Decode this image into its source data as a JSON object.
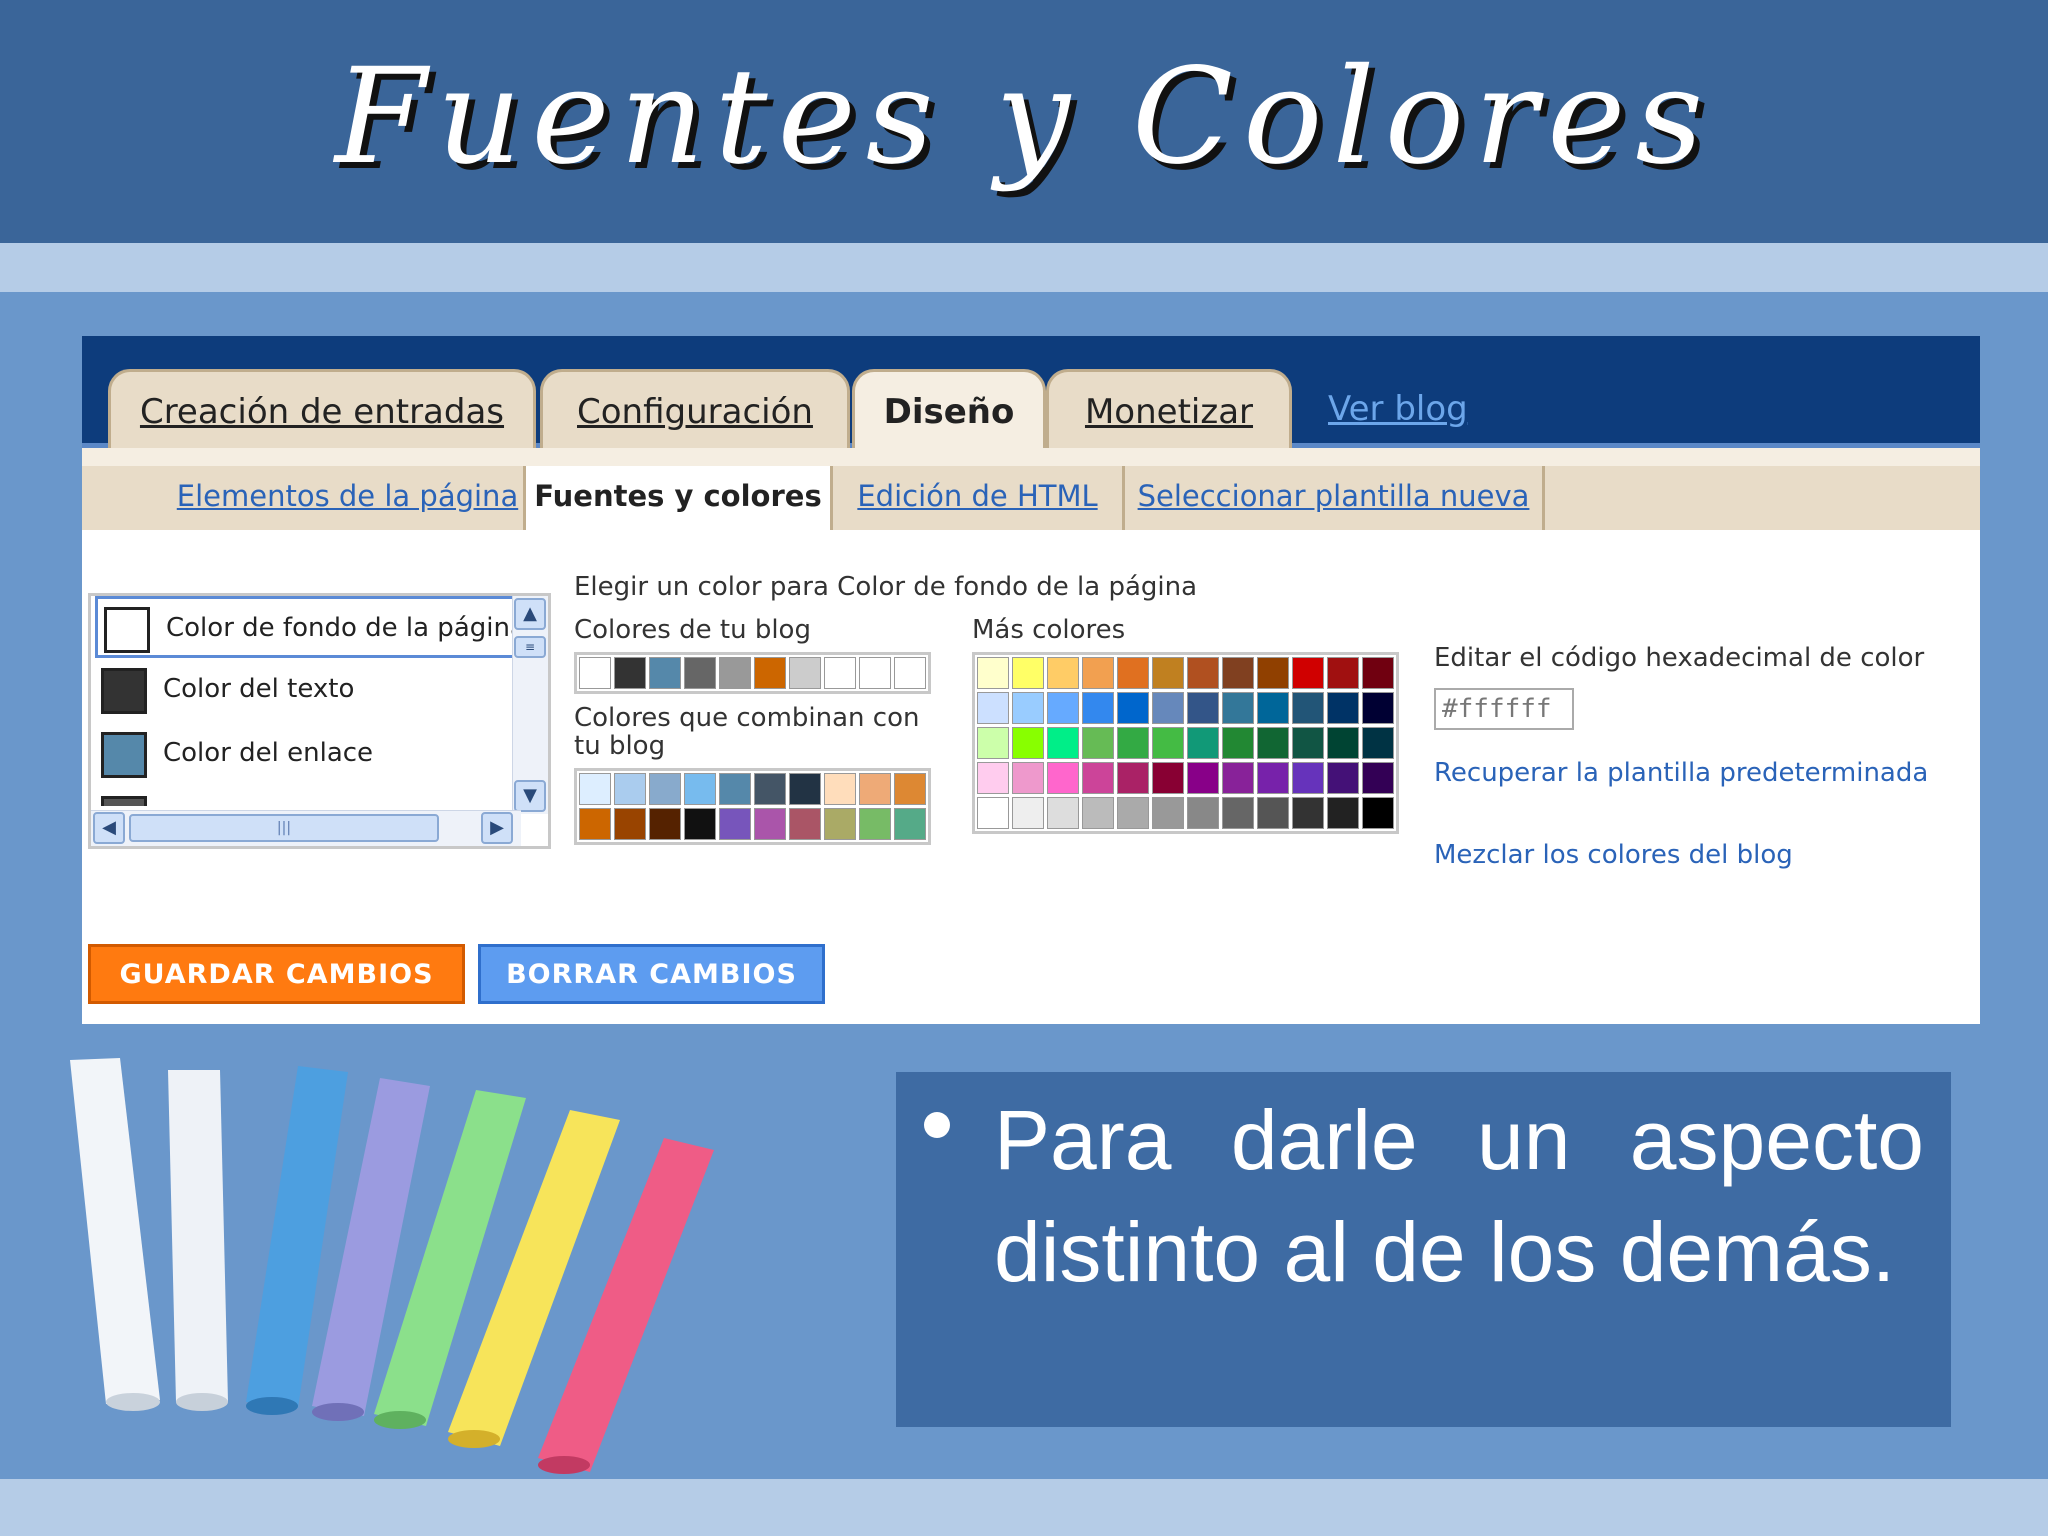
{
  "slide": {
    "title": "Fuentes y Colores",
    "bullet": "Para darle un aspecto distinto al de los demás."
  },
  "main_tabs": [
    {
      "label": "Creación de entradas",
      "active": false
    },
    {
      "label": "Configuración",
      "active": false
    },
    {
      "label": "Diseño",
      "active": true
    },
    {
      "label": "Monetizar",
      "active": false
    }
  ],
  "view_blog_link": "Ver blog",
  "sub_tabs": [
    {
      "label": "Elementos de la página",
      "active": false
    },
    {
      "label": "Fuentes y colores",
      "active": true
    },
    {
      "label": "Edición de HTML",
      "active": false
    },
    {
      "label": "Seleccionar plantilla nueva",
      "active": false
    }
  ],
  "color_list": [
    {
      "label": "Color de fondo de la página",
      "swatch": "#ffffff",
      "selected": true
    },
    {
      "label": "Color del texto",
      "swatch": "#333333",
      "selected": false
    },
    {
      "label": "Color del enlace",
      "swatch": "#5588aa",
      "selected": false
    }
  ],
  "picker": {
    "heading": "Elegir un color para Color de fondo de la página",
    "blog_colors_label": "Colores de tu blog",
    "matching_label_line1": "Colores que combinan con",
    "matching_label_line2": "tu blog",
    "more_colors_label": "Más colores",
    "hex_label": "Editar el código hexadecimal de color",
    "hex_value": "#ffffff",
    "restore_link": "Recuperar la plantilla predeterminada",
    "mix_link": "Mezclar los colores del blog"
  },
  "blog_colors": [
    "#ffffff",
    "#333333",
    "#5588aa",
    "#666666",
    "#999999",
    "#cc6600",
    "#cccccc",
    "#ffffff",
    "#ffffff",
    "#ffffff"
  ],
  "matching_colors": [
    [
      "#ddeeff",
      "#aaccee",
      "#88aacc",
      "#77bbee",
      "#5588aa",
      "#445566",
      "#223344",
      "#ffddbb",
      "#eeaa77",
      "#dd8833"
    ],
    [
      "#cc6600",
      "#994400",
      "#552200",
      "#111111",
      "#7755bb",
      "#aa55aa",
      "#aa5566",
      "#aaaa66",
      "#77bb66",
      "#55aa88"
    ]
  ],
  "more_colors": [
    [
      "#ffffcc",
      "#ffff66",
      "#ffcc66",
      "#f2a050",
      "#e07020",
      "#c08020",
      "#b05020",
      "#804020",
      "#904000",
      "#d00000",
      "#a01010",
      "#700010"
    ],
    [
      "#cce0ff",
      "#99ccff",
      "#66aaff",
      "#3388ee",
      "#0066cc",
      "#6688bb",
      "#335588",
      "#337799",
      "#006699",
      "#225577",
      "#003366",
      "#000033"
    ],
    [
      "#ccffaa",
      "#88ff00",
      "#00ee88",
      "#66bb55",
      "#33aa44",
      "#44bb44",
      "#119977",
      "#228833",
      "#116633",
      "#115544",
      "#004433",
      "#003344"
    ],
    [
      "#ffccee",
      "#ee99cc",
      "#ff66cc",
      "#cc4499",
      "#aa2266",
      "#880033",
      "#880088",
      "#882299",
      "#7722aa",
      "#6633bb",
      "#441177",
      "#330055"
    ],
    [
      "#ffffff",
      "#eeeeee",
      "#dddddd",
      "#bbbbbb",
      "#aaaaaa",
      "#999999",
      "#888888",
      "#666666",
      "#555555",
      "#333333",
      "#222222",
      "#000000"
    ]
  ],
  "buttons": {
    "save": "GUARDAR CAMBIOS",
    "clear": "BORRAR CAMBIOS"
  },
  "colors": {
    "header_bg": "#3a6599",
    "slide_bg": "#6a97cb",
    "band": "#b5cce7",
    "bullet_box": "#3e6ba3",
    "save_button": "#ff7a10",
    "clear_button": "#5d9cf0"
  },
  "icons": [
    "scroll-up-arrow-icon",
    "scroll-down-arrow-icon",
    "scroll-left-arrow-icon",
    "scroll-right-arrow-icon",
    "chalk-sticks-image"
  ]
}
